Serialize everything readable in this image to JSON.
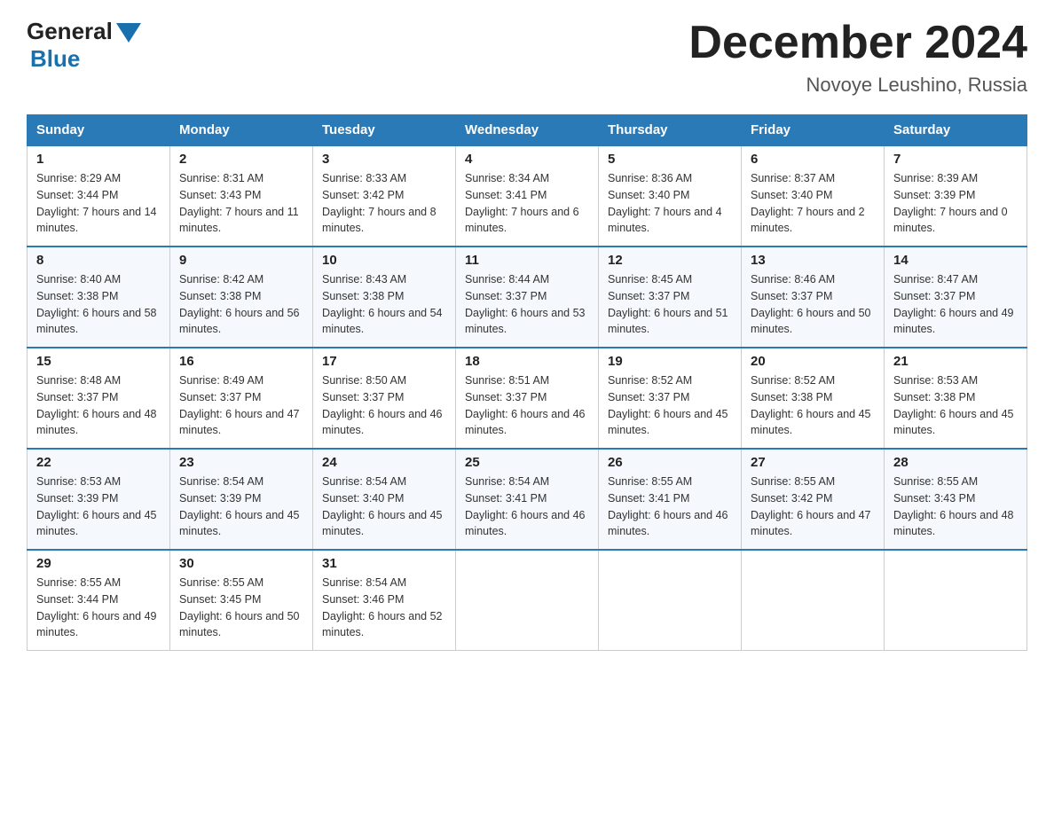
{
  "header": {
    "logo_general": "General",
    "logo_blue": "Blue",
    "title": "December 2024",
    "subtitle": "Novoye Leushino, Russia"
  },
  "weekdays": [
    "Sunday",
    "Monday",
    "Tuesday",
    "Wednesday",
    "Thursday",
    "Friday",
    "Saturday"
  ],
  "weeks": [
    [
      {
        "day": "1",
        "sunrise": "Sunrise: 8:29 AM",
        "sunset": "Sunset: 3:44 PM",
        "daylight": "Daylight: 7 hours and 14 minutes."
      },
      {
        "day": "2",
        "sunrise": "Sunrise: 8:31 AM",
        "sunset": "Sunset: 3:43 PM",
        "daylight": "Daylight: 7 hours and 11 minutes."
      },
      {
        "day": "3",
        "sunrise": "Sunrise: 8:33 AM",
        "sunset": "Sunset: 3:42 PM",
        "daylight": "Daylight: 7 hours and 8 minutes."
      },
      {
        "day": "4",
        "sunrise": "Sunrise: 8:34 AM",
        "sunset": "Sunset: 3:41 PM",
        "daylight": "Daylight: 7 hours and 6 minutes."
      },
      {
        "day": "5",
        "sunrise": "Sunrise: 8:36 AM",
        "sunset": "Sunset: 3:40 PM",
        "daylight": "Daylight: 7 hours and 4 minutes."
      },
      {
        "day": "6",
        "sunrise": "Sunrise: 8:37 AM",
        "sunset": "Sunset: 3:40 PM",
        "daylight": "Daylight: 7 hours and 2 minutes."
      },
      {
        "day": "7",
        "sunrise": "Sunrise: 8:39 AM",
        "sunset": "Sunset: 3:39 PM",
        "daylight": "Daylight: 7 hours and 0 minutes."
      }
    ],
    [
      {
        "day": "8",
        "sunrise": "Sunrise: 8:40 AM",
        "sunset": "Sunset: 3:38 PM",
        "daylight": "Daylight: 6 hours and 58 minutes."
      },
      {
        "day": "9",
        "sunrise": "Sunrise: 8:42 AM",
        "sunset": "Sunset: 3:38 PM",
        "daylight": "Daylight: 6 hours and 56 minutes."
      },
      {
        "day": "10",
        "sunrise": "Sunrise: 8:43 AM",
        "sunset": "Sunset: 3:38 PM",
        "daylight": "Daylight: 6 hours and 54 minutes."
      },
      {
        "day": "11",
        "sunrise": "Sunrise: 8:44 AM",
        "sunset": "Sunset: 3:37 PM",
        "daylight": "Daylight: 6 hours and 53 minutes."
      },
      {
        "day": "12",
        "sunrise": "Sunrise: 8:45 AM",
        "sunset": "Sunset: 3:37 PM",
        "daylight": "Daylight: 6 hours and 51 minutes."
      },
      {
        "day": "13",
        "sunrise": "Sunrise: 8:46 AM",
        "sunset": "Sunset: 3:37 PM",
        "daylight": "Daylight: 6 hours and 50 minutes."
      },
      {
        "day": "14",
        "sunrise": "Sunrise: 8:47 AM",
        "sunset": "Sunset: 3:37 PM",
        "daylight": "Daylight: 6 hours and 49 minutes."
      }
    ],
    [
      {
        "day": "15",
        "sunrise": "Sunrise: 8:48 AM",
        "sunset": "Sunset: 3:37 PM",
        "daylight": "Daylight: 6 hours and 48 minutes."
      },
      {
        "day": "16",
        "sunrise": "Sunrise: 8:49 AM",
        "sunset": "Sunset: 3:37 PM",
        "daylight": "Daylight: 6 hours and 47 minutes."
      },
      {
        "day": "17",
        "sunrise": "Sunrise: 8:50 AM",
        "sunset": "Sunset: 3:37 PM",
        "daylight": "Daylight: 6 hours and 46 minutes."
      },
      {
        "day": "18",
        "sunrise": "Sunrise: 8:51 AM",
        "sunset": "Sunset: 3:37 PM",
        "daylight": "Daylight: 6 hours and 46 minutes."
      },
      {
        "day": "19",
        "sunrise": "Sunrise: 8:52 AM",
        "sunset": "Sunset: 3:37 PM",
        "daylight": "Daylight: 6 hours and 45 minutes."
      },
      {
        "day": "20",
        "sunrise": "Sunrise: 8:52 AM",
        "sunset": "Sunset: 3:38 PM",
        "daylight": "Daylight: 6 hours and 45 minutes."
      },
      {
        "day": "21",
        "sunrise": "Sunrise: 8:53 AM",
        "sunset": "Sunset: 3:38 PM",
        "daylight": "Daylight: 6 hours and 45 minutes."
      }
    ],
    [
      {
        "day": "22",
        "sunrise": "Sunrise: 8:53 AM",
        "sunset": "Sunset: 3:39 PM",
        "daylight": "Daylight: 6 hours and 45 minutes."
      },
      {
        "day": "23",
        "sunrise": "Sunrise: 8:54 AM",
        "sunset": "Sunset: 3:39 PM",
        "daylight": "Daylight: 6 hours and 45 minutes."
      },
      {
        "day": "24",
        "sunrise": "Sunrise: 8:54 AM",
        "sunset": "Sunset: 3:40 PM",
        "daylight": "Daylight: 6 hours and 45 minutes."
      },
      {
        "day": "25",
        "sunrise": "Sunrise: 8:54 AM",
        "sunset": "Sunset: 3:41 PM",
        "daylight": "Daylight: 6 hours and 46 minutes."
      },
      {
        "day": "26",
        "sunrise": "Sunrise: 8:55 AM",
        "sunset": "Sunset: 3:41 PM",
        "daylight": "Daylight: 6 hours and 46 minutes."
      },
      {
        "day": "27",
        "sunrise": "Sunrise: 8:55 AM",
        "sunset": "Sunset: 3:42 PM",
        "daylight": "Daylight: 6 hours and 47 minutes."
      },
      {
        "day": "28",
        "sunrise": "Sunrise: 8:55 AM",
        "sunset": "Sunset: 3:43 PM",
        "daylight": "Daylight: 6 hours and 48 minutes."
      }
    ],
    [
      {
        "day": "29",
        "sunrise": "Sunrise: 8:55 AM",
        "sunset": "Sunset: 3:44 PM",
        "daylight": "Daylight: 6 hours and 49 minutes."
      },
      {
        "day": "30",
        "sunrise": "Sunrise: 8:55 AM",
        "sunset": "Sunset: 3:45 PM",
        "daylight": "Daylight: 6 hours and 50 minutes."
      },
      {
        "day": "31",
        "sunrise": "Sunrise: 8:54 AM",
        "sunset": "Sunset: 3:46 PM",
        "daylight": "Daylight: 6 hours and 52 minutes."
      },
      null,
      null,
      null,
      null
    ]
  ]
}
